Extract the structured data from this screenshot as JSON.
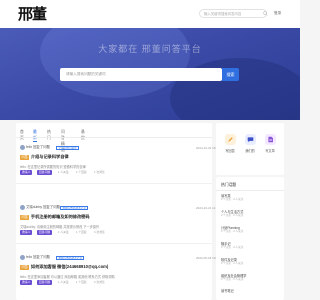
{
  "header": {
    "logo_text": "邢董",
    "search_placeholder": "输入关键词搜索问答内容",
    "login_label": "登录"
  },
  "hero": {
    "title": "大家都在 邢董问答平台",
    "search_placeholder": "请输入搜索问题的关键词",
    "search_button": "搜索"
  },
  "tabs": [
    "首页",
    "最新",
    "热门",
    "问答精选",
    "悬赏"
  ],
  "posts": [
    {
      "author": "felix 回复了问题",
      "tag": "记录问题与解答",
      "badge": "问答",
      "title": "介绍与记录科学自律",
      "date": "2024-10-22 16:53",
      "excerpt": "felix: 在这里记录所需要的知识 遵循科学的自律",
      "pill1": "邀请人",
      "pill2": "回答问题",
      "meta1": "1 人关注",
      "meta2": "1 个回复",
      "meta3": "1 次浏览"
    },
    {
      "author": "艾瑞dubby 回复了问题",
      "tag": "电脑与数码技术记录",
      "badge": "问答",
      "title": "手机注册的邮箱及如何修改密码",
      "date": "2024-10-21 11:03",
      "excerpt": "艾瑞dubby: 请使用注册的邮箱 并按提示修改 下一步操作",
      "pill1": "邀请人",
      "pill2": "回答问题",
      "meta1": "1 人关注",
      "meta2": "1 个回复",
      "meta3": "4 次浏览"
    },
    {
      "author": "felix 回复了问题",
      "tag": "电脑与数码技术记录",
      "badge": "问答",
      "title": "如何添加客服 微信(244668910@qq.com)",
      "date": "2022-05-18 19:19",
      "excerpt": "felix: 在这里添加客服 可以通过 添加邮箱 或其他 联系方式 获取帮助",
      "pill1": "邀请人",
      "pill2": "回答问题",
      "meta1": "1 人关注",
      "meta2": "1 个回复",
      "meta3": "2 次浏览"
    }
  ],
  "side_actions": [
    {
      "label": "写回答",
      "icon": "pencil-icon",
      "bg": "#fdf1dc",
      "fg": "#e8a33a"
    },
    {
      "label": "我们的",
      "icon": "chat-icon",
      "bg": "#e9edff",
      "fg": "#3b4fc7"
    },
    {
      "label": "写文章",
      "icon": "document-icon",
      "bg": "#f3e8ff",
      "fg": "#8a54d6"
    }
  ],
  "hot_topics": {
    "heading": "热门话题",
    "items": [
      {
        "title": "读写类",
        "sub": "0 个讨论 · 0 人关注"
      },
      {
        "title": "个人与生活方式",
        "sub": "0 个讨论 · 0 人关注"
      },
      {
        "title": "计划Planning",
        "sub": "0 个讨论 · 0 人关注"
      },
      {
        "title": "随手记",
        "sub": "0 个讨论 · 0 人关注"
      },
      {
        "title": "软件及记录",
        "sub": "0 个讨论 · 0 人关注"
      },
      {
        "title": "组织及社会管理学",
        "sub": "0 个讨论 · 0 人关注"
      },
      {
        "title": "读书笔记",
        "sub": "0 个讨论 · 0 人关注"
      }
    ]
  },
  "colors": {
    "accent": "#2f6fe0",
    "hero": "#3a4aa6",
    "badge": "#e8a33a",
    "pill": "#6b4ed1"
  }
}
